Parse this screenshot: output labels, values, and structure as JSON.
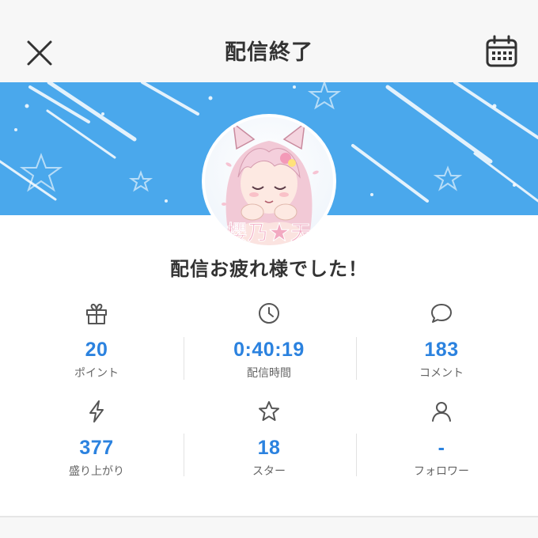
{
  "header": {
    "title": "配信終了"
  },
  "avatar_logo_text": "櫻乃★天",
  "message": "配信お疲れ様でした！",
  "stats": [
    {
      "icon": "gift-icon",
      "value": "20",
      "label": "ポイント"
    },
    {
      "icon": "clock-icon",
      "value": "0:40:19",
      "label": "配信時間"
    },
    {
      "icon": "comment-icon",
      "value": "183",
      "label": "コメント"
    },
    {
      "icon": "lightning-icon",
      "value": "377",
      "label": "盛り上がり"
    },
    {
      "icon": "star-icon",
      "value": "18",
      "label": "スター"
    },
    {
      "icon": "person-icon",
      "value": "-",
      "label": "フォロワー"
    }
  ],
  "colors": {
    "banner": "#4aa8ec",
    "value": "#2b82df",
    "icon": "#555555"
  }
}
